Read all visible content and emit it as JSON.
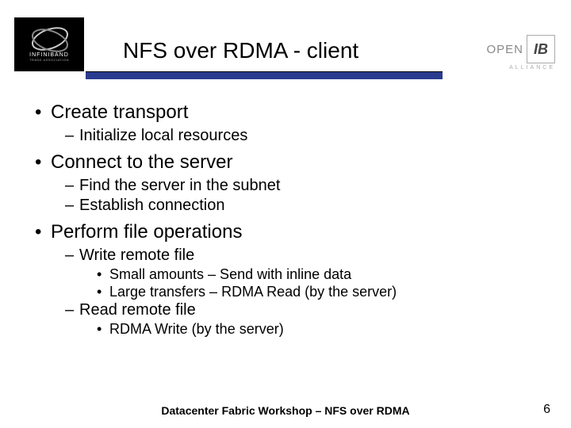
{
  "header": {
    "title": "NFS over RDMA - client",
    "logo_left": {
      "line1": "INFINIBAND",
      "line2": "TRADE ASSOCIATION"
    },
    "logo_right": {
      "text": "OPEN",
      "mark": "IB",
      "sub": "ALLIANCE"
    }
  },
  "bullets": {
    "b1": "Create transport",
    "b1_1": "Initialize local resources",
    "b2": "Connect to the server",
    "b2_1": "Find the server in the subnet",
    "b2_2": "Establish connection",
    "b3": "Perform file operations",
    "b3_1": "Write remote file",
    "b3_1_1": "Small amounts – Send with inline data",
    "b3_1_2": "Large transfers – RDMA Read (by the server)",
    "b3_2": "Read remote file",
    "b3_2_1": "RDMA Write (by the server)"
  },
  "footer": {
    "text": "Datacenter Fabric Workshop – NFS over RDMA",
    "page": "6"
  }
}
